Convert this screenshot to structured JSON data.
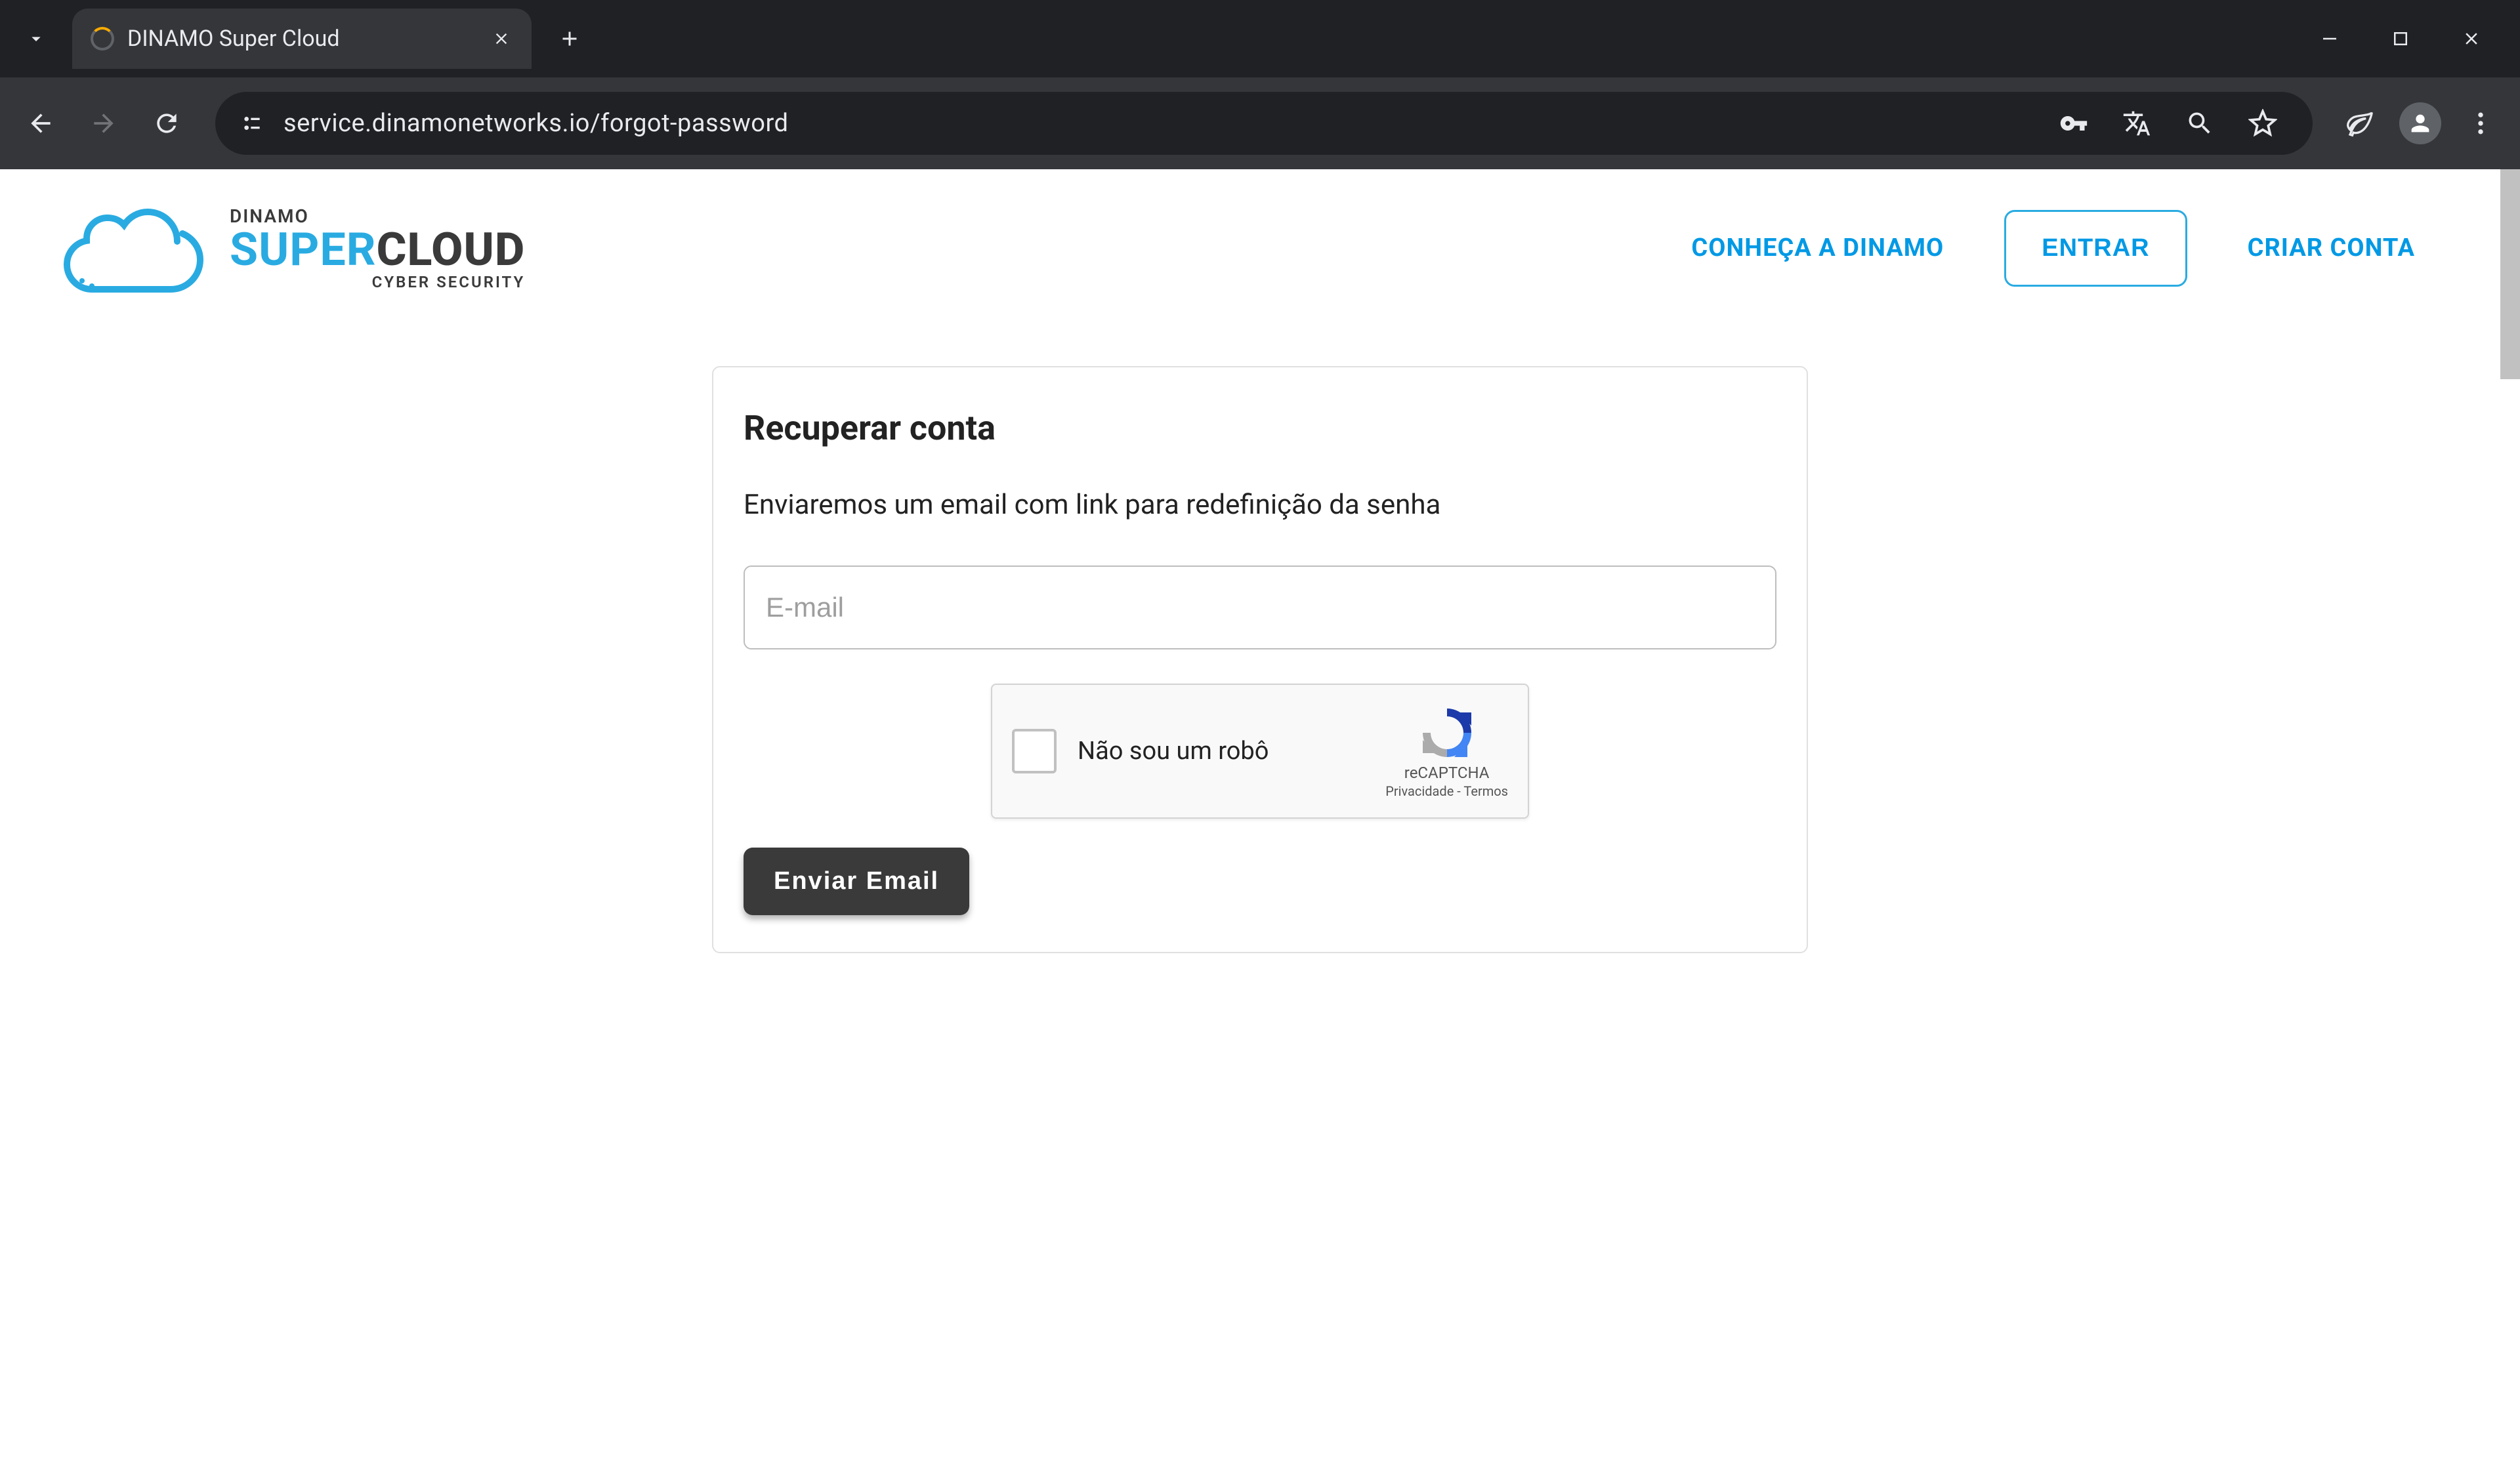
{
  "browser": {
    "tab_title": "DINAMO Super Cloud",
    "url": "service.dinamonetworks.io/forgot-password"
  },
  "header": {
    "logo": {
      "line1": "DINAMO",
      "super": "SUPER",
      "cloud": "CLOUD",
      "tagline": "CYBER SECURITY"
    },
    "nav": {
      "conheca": "CONHEÇA A DINAMO",
      "entrar": "ENTRAR",
      "criar": "CRIAR CONTA"
    }
  },
  "card": {
    "title": "Recuperar conta",
    "description": "Enviaremos um email com link para redefinição da senha",
    "email_placeholder": "E-mail",
    "submit_label": "Enviar Email"
  },
  "recaptcha": {
    "label": "Não sou um robô",
    "brand": "reCAPTCHA",
    "privacy": "Privacidade",
    "sep": " - ",
    "terms": "Termos"
  }
}
